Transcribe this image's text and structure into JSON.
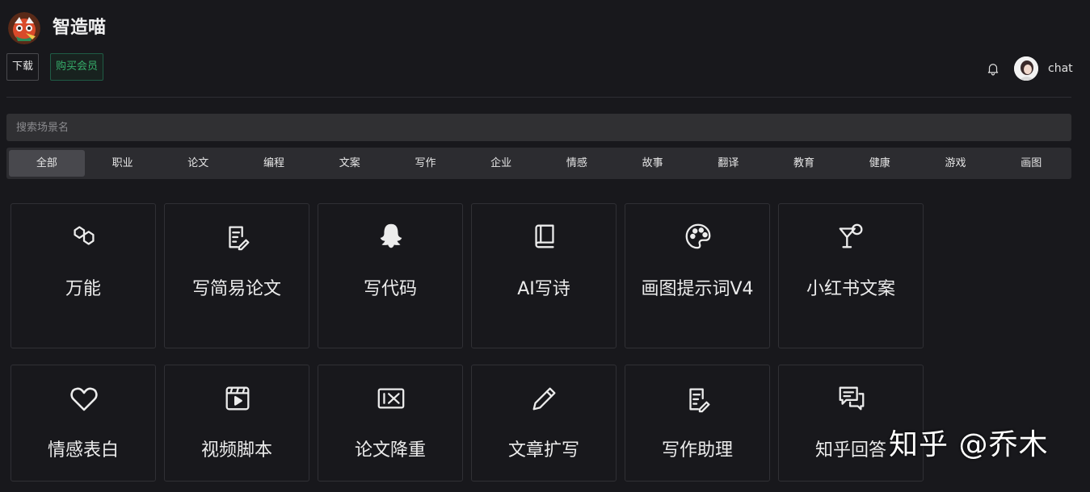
{
  "header": {
    "app_title": "智造喵",
    "download_label": "下载",
    "vip_label": "购买会员",
    "username": "chat"
  },
  "search": {
    "placeholder": "搜索场景名"
  },
  "tabs": [
    {
      "label": "全部",
      "active": true
    },
    {
      "label": "职业"
    },
    {
      "label": "论文"
    },
    {
      "label": "编程"
    },
    {
      "label": "文案"
    },
    {
      "label": "写作"
    },
    {
      "label": "企业"
    },
    {
      "label": "情感"
    },
    {
      "label": "故事"
    },
    {
      "label": "翻译"
    },
    {
      "label": "教育"
    },
    {
      "label": "健康"
    },
    {
      "label": "游戏"
    },
    {
      "label": "画图"
    }
  ],
  "cards": [
    {
      "label": "万能",
      "icon": "hexagons-icon"
    },
    {
      "label": "写简易论文",
      "icon": "document-edit-icon"
    },
    {
      "label": "写代码",
      "icon": "ghost-icon"
    },
    {
      "label": "AI写诗",
      "icon": "book-icon"
    },
    {
      "label": "画图提示词V4",
      "icon": "palette-icon"
    },
    {
      "label": "小红书文案",
      "icon": "cocktail-icon"
    },
    {
      "label": "情感表白",
      "icon": "heart-icon"
    },
    {
      "label": "视频脚本",
      "icon": "video-icon"
    },
    {
      "label": "论文降重",
      "icon": "reduce-icon"
    },
    {
      "label": "文章扩写",
      "icon": "pencil-icon"
    },
    {
      "label": "写作助理",
      "icon": "document-edit-icon"
    },
    {
      "label": "知乎回答",
      "icon": "chat-bubbles-icon"
    }
  ],
  "watermark": "知乎 @乔木"
}
